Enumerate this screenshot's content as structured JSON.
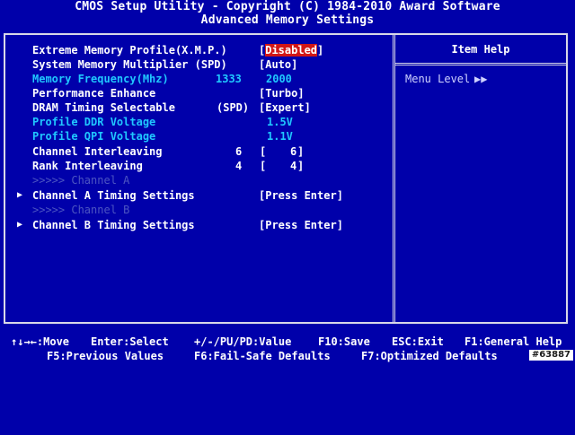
{
  "header": {
    "line1": "CMOS Setup Utility - Copyright (C) 1984-2010 Award Software",
    "line2": "Advanced Memory Settings"
  },
  "help": {
    "title": "Item Help",
    "menu_level_label": "Menu Level",
    "menu_level_marker": "▶▶"
  },
  "settings": [
    {
      "label": "Extreme Memory Profile(X.M.P.)",
      "mid": "",
      "prefix": "[",
      "value": "Disabled",
      "suffix": "]",
      "arrow": ""
    },
    {
      "label": "System Memory Multiplier (SPD)",
      "mid": "",
      "prefix": "[",
      "value": "Auto",
      "suffix": "]",
      "arrow": ""
    },
    {
      "label": "Memory Frequency(Mhz)",
      "mid": "1333",
      "prefix": "",
      "value": "2000",
      "suffix": "",
      "arrow": ""
    },
    {
      "label": "Performance Enhance",
      "mid": "",
      "prefix": "[",
      "value": "Turbo",
      "suffix": "]",
      "arrow": ""
    },
    {
      "label": "DRAM Timing Selectable",
      "mid": "(SPD)",
      "prefix": "[",
      "value": "Expert",
      "suffix": "]",
      "arrow": ""
    },
    {
      "label": "Profile DDR Voltage",
      "mid": "",
      "prefix": "",
      "value": "1.5V",
      "suffix": "",
      "arrow": ""
    },
    {
      "label": "Profile QPI Voltage",
      "mid": "",
      "prefix": "",
      "value": "1.1V",
      "suffix": "",
      "arrow": ""
    },
    {
      "label": "Channel Interleaving",
      "mid": "6",
      "prefix": "[",
      "value": "6",
      "suffix": "]",
      "arrow": ""
    },
    {
      "label": "Rank Interleaving",
      "mid": "4",
      "prefix": "[",
      "value": "4",
      "suffix": "]",
      "arrow": ""
    },
    {
      "label": ">>>>> Channel A",
      "mid": "",
      "prefix": "",
      "value": "",
      "suffix": "",
      "arrow": ""
    },
    {
      "label": "Channel A Timing Settings",
      "mid": "",
      "prefix": "[",
      "value": "Press Enter",
      "suffix": "]",
      "arrow": "▶"
    },
    {
      "label": ">>>>> Channel B",
      "mid": "",
      "prefix": "",
      "value": "",
      "suffix": "",
      "arrow": ""
    },
    {
      "label": "Channel B Timing Settings",
      "mid": "",
      "prefix": "[",
      "value": "Press Enter",
      "suffix": "]",
      "arrow": "▶"
    }
  ],
  "footer": {
    "row1": [
      "↑↓→←:Move",
      "Enter:Select",
      "+/-/PU/PD:Value",
      "F10:Save",
      "ESC:Exit",
      "F1:General Help"
    ],
    "row2": [
      "F5:Previous Values",
      "F6:Fail-Safe Defaults",
      "F7:Optimized Defaults"
    ]
  },
  "watermark": "#63887",
  "colors": {
    "background": "#0000aa",
    "text": "#ffffff",
    "disabled_cyan": "#20c8ff",
    "dim": "#4c55c2",
    "highlight": "#d21616"
  }
}
